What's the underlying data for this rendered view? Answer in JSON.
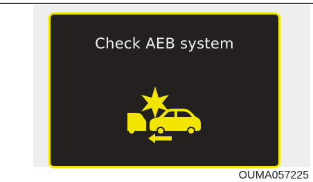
{
  "display": {
    "message": "Check AEB system",
    "icon": "forward-collision-warning-icon",
    "accent_color": "#f2e600",
    "background_color": "#222120",
    "text_color": "#f4f4f4"
  },
  "caption": "OUMA057225"
}
